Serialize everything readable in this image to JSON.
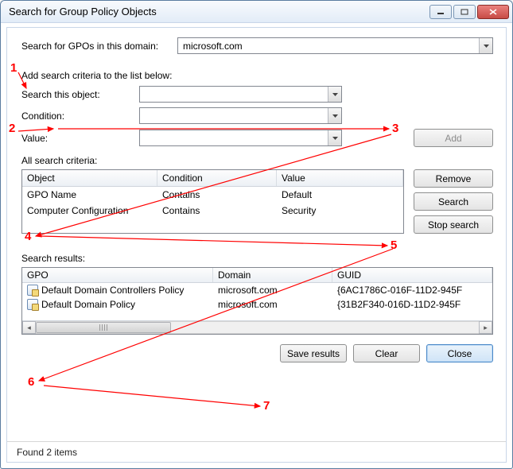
{
  "window": {
    "title": "Search for Group Policy Objects"
  },
  "domain_row": {
    "label": "Search for GPOs in this domain:",
    "value": "microsoft.com"
  },
  "criteria_prompt": "Add search criteria to the list below:",
  "search_this_object": {
    "label": "Search this object:",
    "value": ""
  },
  "condition_row": {
    "label": "Condition:",
    "value": ""
  },
  "value_row": {
    "label": "Value:",
    "value": ""
  },
  "add_button": "Add",
  "all_criteria_label": "All search criteria:",
  "criteria_headers": {
    "object": "Object",
    "condition": "Condition",
    "value": "Value"
  },
  "criteria_rows": [
    {
      "object": "GPO Name",
      "condition": "Contains",
      "value": "Default"
    },
    {
      "object": "Computer Configuration",
      "condition": "Contains",
      "value": "Security"
    }
  ],
  "side_buttons": {
    "remove": "Remove",
    "search": "Search",
    "stop": "Stop search"
  },
  "results_label": "Search results:",
  "results_headers": {
    "gpo": "GPO",
    "domain": "Domain",
    "guid": "GUID"
  },
  "results_rows": [
    {
      "gpo": "Default Domain Controllers Policy",
      "domain": "microsoft.com",
      "guid": "{6AC1786C-016F-11D2-945F"
    },
    {
      "gpo": "Default Domain Policy",
      "domain": "microsoft.com",
      "guid": "{31B2F340-016D-11D2-945F"
    }
  ],
  "bottom_buttons": {
    "save": "Save results",
    "clear": "Clear",
    "close": "Close"
  },
  "status": "Found 2 items",
  "annotations": [
    "1",
    "2",
    "3",
    "4",
    "5",
    "6",
    "7"
  ]
}
